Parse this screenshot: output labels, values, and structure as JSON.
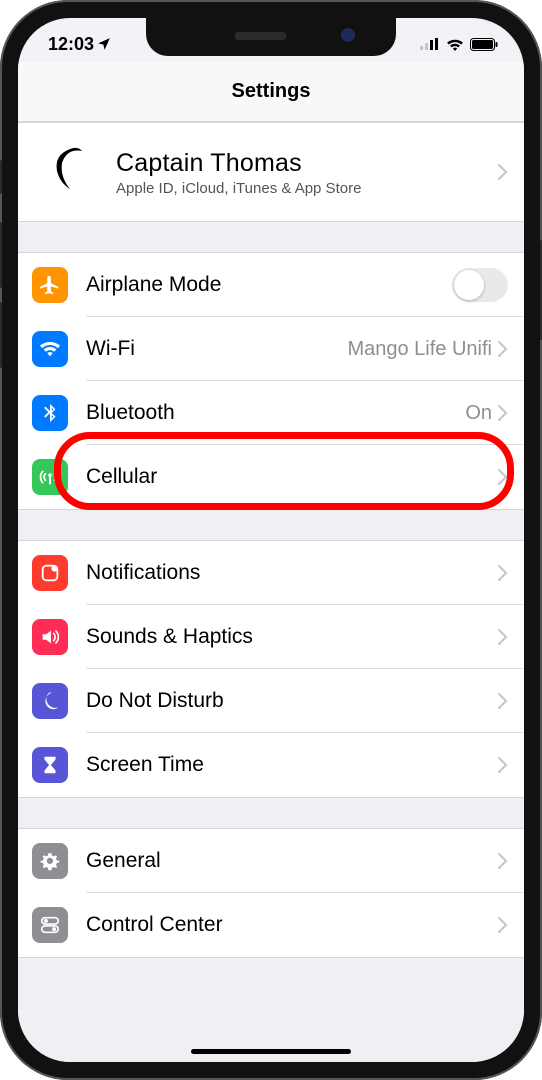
{
  "status": {
    "time": "12:03",
    "location_icon": "location-arrow"
  },
  "nav": {
    "title": "Settings"
  },
  "profile": {
    "name": "Captain Thomas",
    "subtitle": "Apple ID, iCloud, iTunes & App Store"
  },
  "groups": [
    {
      "items": [
        {
          "id": "airplane",
          "label": "Airplane Mode",
          "icon": "airplane-icon",
          "color": "#ff9500",
          "type": "toggle",
          "toggle_on": false
        },
        {
          "id": "wifi",
          "label": "Wi-Fi",
          "icon": "wifi-icon",
          "color": "#007aff",
          "type": "link",
          "detail": "Mango Life Unifi"
        },
        {
          "id": "bluetooth",
          "label": "Bluetooth",
          "icon": "bluetooth-icon",
          "color": "#007aff",
          "type": "link",
          "detail": "On",
          "highlighted": true
        },
        {
          "id": "cellular",
          "label": "Cellular",
          "icon": "cellular-icon",
          "color": "#34c759",
          "type": "link"
        }
      ]
    },
    {
      "items": [
        {
          "id": "notifications",
          "label": "Notifications",
          "icon": "notifications-icon",
          "color": "#ff3b30",
          "type": "link"
        },
        {
          "id": "sounds",
          "label": "Sounds & Haptics",
          "icon": "sounds-icon",
          "color": "#ff2d55",
          "type": "link"
        },
        {
          "id": "dnd",
          "label": "Do Not Disturb",
          "icon": "moon-icon",
          "color": "#5856d6",
          "type": "link"
        },
        {
          "id": "screentime",
          "label": "Screen Time",
          "icon": "hourglass-icon",
          "color": "#5856d6",
          "type": "link"
        }
      ]
    },
    {
      "items": [
        {
          "id": "general",
          "label": "General",
          "icon": "gear-icon",
          "color": "#8e8e93",
          "type": "link"
        },
        {
          "id": "controlcenter",
          "label": "Control Center",
          "icon": "switches-icon",
          "color": "#8e8e93",
          "type": "link"
        }
      ]
    }
  ]
}
